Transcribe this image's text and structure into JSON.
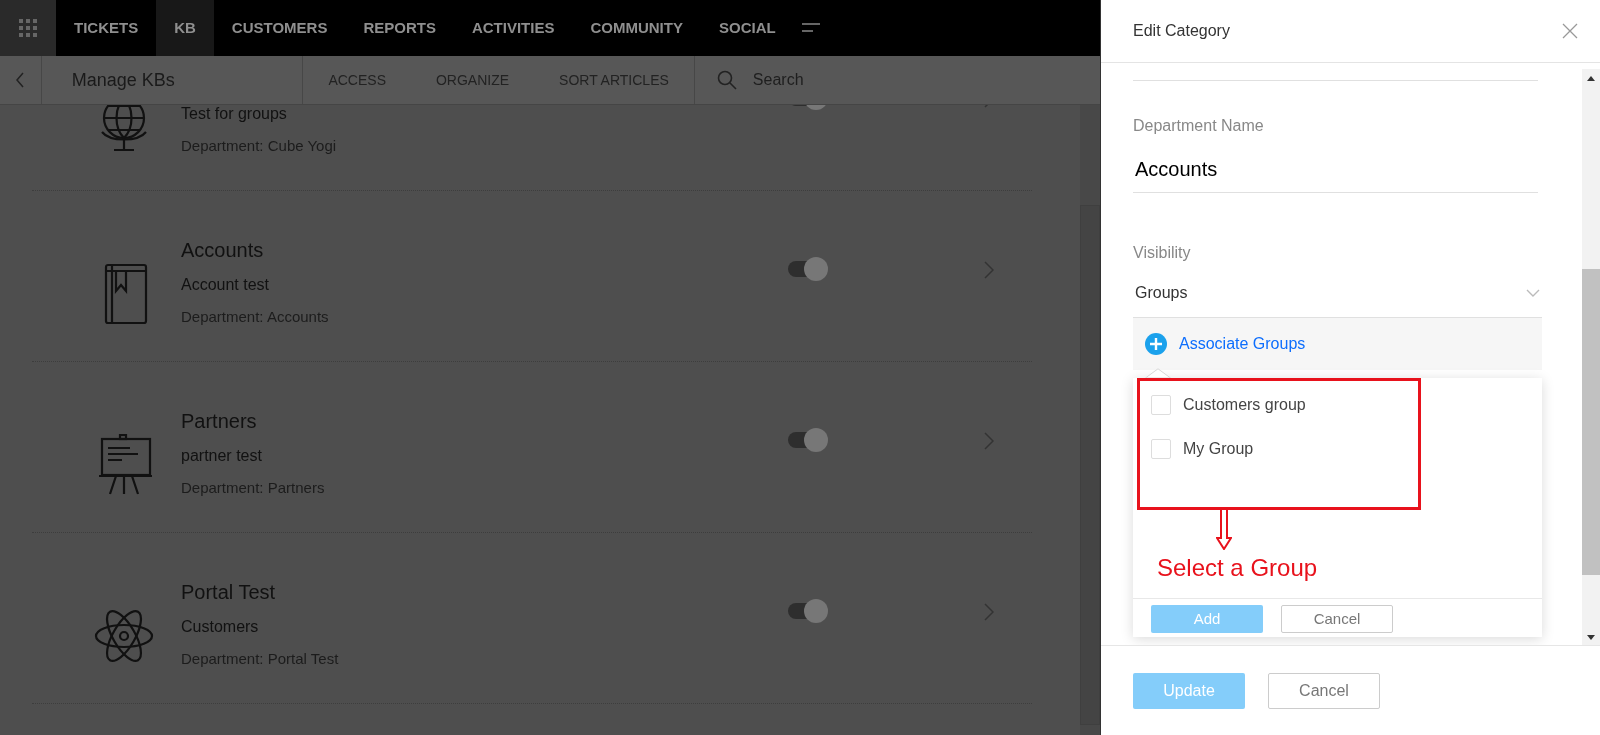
{
  "nav": {
    "tabs": [
      {
        "label": "TICKETS",
        "selected": false
      },
      {
        "label": "KB",
        "selected": true
      },
      {
        "label": "CUSTOMERS",
        "selected": false
      },
      {
        "label": "REPORTS",
        "selected": false
      },
      {
        "label": "ACTIVITIES",
        "selected": false
      },
      {
        "label": "COMMUNITY",
        "selected": false
      },
      {
        "label": "SOCIAL",
        "selected": false
      }
    ]
  },
  "subbar": {
    "title": "Manage KBs",
    "links": [
      "ACCESS",
      "ORGANIZE",
      "SORT ARTICLES"
    ],
    "search": {
      "placeholder": "Search"
    }
  },
  "categories": [
    {
      "kind": "globe",
      "description": "Test for groups",
      "department": "Department: Cube Yogi",
      "on": true
    },
    {
      "kind": "book",
      "name": "Accounts",
      "description": "Account test",
      "department": "Department: Accounts",
      "on": true
    },
    {
      "kind": "easel",
      "name": "Partners",
      "description": "partner test",
      "department": "Department: Partners",
      "on": true
    },
    {
      "kind": "atom",
      "name": "Portal Test",
      "description": "Customers",
      "department": "Department: Portal Test",
      "on": true
    }
  ],
  "panel": {
    "title": "Edit Category",
    "department_name": {
      "label": "Department Name",
      "value": "Accounts"
    },
    "visibility": {
      "label": "Visibility",
      "value": "Groups"
    },
    "associate": "Associate Groups",
    "groups": [
      {
        "label": "Customers group",
        "checked": false
      },
      {
        "label": "My Group",
        "checked": false
      }
    ],
    "annotation": "Select a Group",
    "popup_buttons": [
      "Add",
      "Cancel"
    ],
    "footer_buttons": [
      "Update",
      "Cancel"
    ]
  }
}
